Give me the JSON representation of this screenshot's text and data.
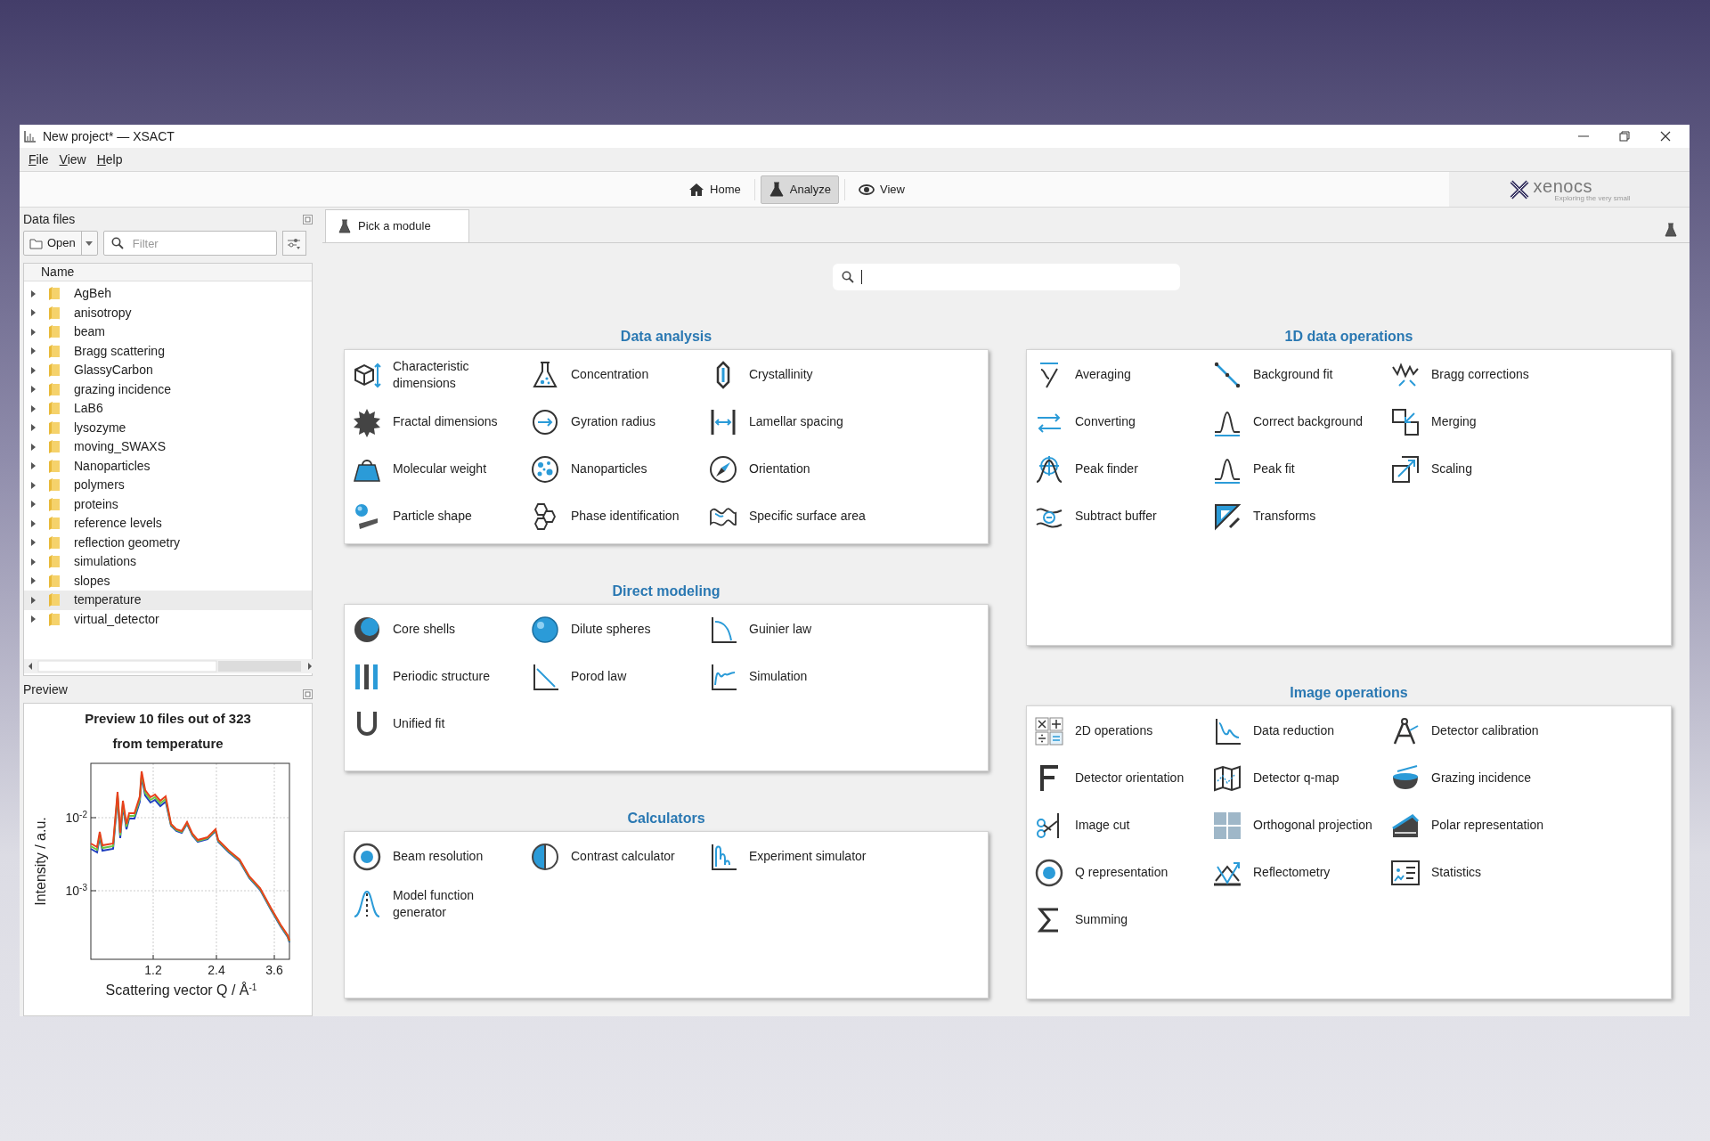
{
  "window": {
    "title": "New project* — XSACT"
  },
  "menu": [
    {
      "label": "File"
    },
    {
      "label": "View"
    },
    {
      "label": "Help"
    }
  ],
  "toolbar": [
    {
      "label": "Home",
      "selected": false
    },
    {
      "label": "Analyze",
      "selected": true
    },
    {
      "label": "View",
      "selected": false
    }
  ],
  "logo": {
    "name": "xenocs",
    "tagline": "Exploring the very small"
  },
  "data_files": {
    "title": "Data files",
    "open_button": "Open",
    "filter_placeholder": "Filter",
    "column": "Name",
    "items": [
      {
        "label": "AgBeh",
        "selected": false
      },
      {
        "label": "anisotropy",
        "selected": false
      },
      {
        "label": "beam",
        "selected": false
      },
      {
        "label": "Bragg scattering",
        "selected": false
      },
      {
        "label": "GlassyCarbon",
        "selected": false
      },
      {
        "label": "grazing incidence",
        "selected": false
      },
      {
        "label": "LaB6",
        "selected": false
      },
      {
        "label": "lysozyme",
        "selected": false
      },
      {
        "label": "moving_SWAXS",
        "selected": false
      },
      {
        "label": "Nanoparticles",
        "selected": false
      },
      {
        "label": "polymers",
        "selected": false
      },
      {
        "label": "proteins",
        "selected": false
      },
      {
        "label": "reference levels",
        "selected": false
      },
      {
        "label": "reflection geometry",
        "selected": false
      },
      {
        "label": "simulations",
        "selected": false
      },
      {
        "label": "slopes",
        "selected": false
      },
      {
        "label": "temperature",
        "selected": true
      },
      {
        "label": "virtual_detector",
        "selected": false
      }
    ]
  },
  "preview": {
    "title": "Preview",
    "plot": {
      "title": "Preview 10 files out of 323 from temperature",
      "xlabel": "Scattering vector Q / Å$^{-1}$",
      "ylabel": "Intensity / a.u.",
      "xtick_labels": [
        "1.2",
        "2.4",
        "3.6"
      ],
      "ytick_labels": [
        "10$^{-2}$",
        "10$^{-3}$"
      ]
    }
  },
  "tabs": [
    {
      "label": "Pick a module",
      "selected": true
    }
  ],
  "left_sections": [
    {
      "title": "Data analysis",
      "items": [
        "Characteristic dimensions",
        "Concentration",
        "Crystallinity",
        "Fractal dimensions",
        "Gyration radius",
        "Lamellar spacing",
        "Molecular weight",
        "Nanoparticles",
        "Orientation",
        "Particle shape",
        "Phase identification",
        "Specific surface area"
      ]
    },
    {
      "title": "Direct modeling",
      "items": [
        "Core shells",
        "Dilute spheres",
        "Guinier law",
        "Periodic structure",
        "Porod law",
        "Simulation",
        "Unified fit"
      ]
    },
    {
      "title": "Calculators",
      "items": [
        "Beam resolution",
        "Contrast calculator",
        "Experiment simulator",
        "Model function generator"
      ]
    }
  ],
  "right_sections": [
    {
      "title": "1D data operations",
      "items": [
        "Averaging",
        "Background fit",
        "Bragg corrections",
        "Converting",
        "Correct background",
        "Merging",
        "Peak finder",
        "Peak fit",
        "Scaling",
        "Subtract buffer",
        "Transforms"
      ]
    },
    {
      "title": "Image operations",
      "items": [
        "2D operations",
        "Data reduction",
        "Detector calibration",
        "Detector orientation",
        "Detector q-map",
        "Grazing incidence",
        "Image cut",
        "Orthogonal projection",
        "Polar representation",
        "Q representation",
        "Reflectometry",
        "Statistics",
        "Summing"
      ]
    }
  ]
}
